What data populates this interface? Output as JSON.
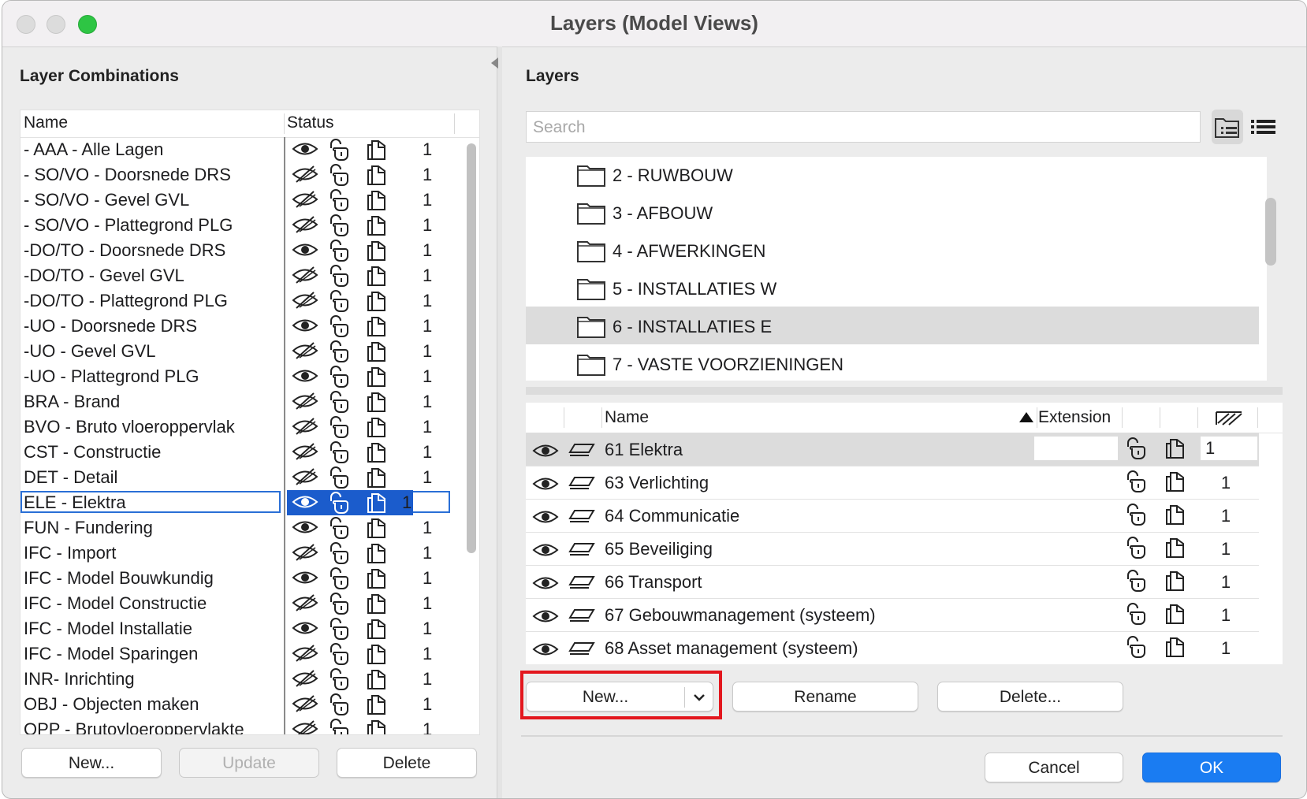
{
  "window": {
    "title": "Layers (Model Views)"
  },
  "left": {
    "section_title": "Layer Combinations",
    "columns": {
      "name": "Name",
      "status": "Status"
    },
    "rows": [
      {
        "name": "- AAA - Alle Lagen",
        "visible": true,
        "count": "1"
      },
      {
        "name": "- SO/VO - Doorsnede DRS",
        "visible": false,
        "count": "1"
      },
      {
        "name": "- SO/VO - Gevel GVL",
        "visible": false,
        "count": "1"
      },
      {
        "name": "- SO/VO - Plattegrond PLG",
        "visible": false,
        "count": "1"
      },
      {
        "name": "-DO/TO - Doorsnede DRS",
        "visible": true,
        "count": "1"
      },
      {
        "name": "-DO/TO - Gevel GVL",
        "visible": false,
        "count": "1"
      },
      {
        "name": "-DO/TO - Plattegrond PLG",
        "visible": false,
        "count": "1"
      },
      {
        "name": "-UO - Doorsnede DRS",
        "visible": true,
        "count": "1"
      },
      {
        "name": "-UO - Gevel GVL",
        "visible": false,
        "count": "1"
      },
      {
        "name": "-UO - Plattegrond PLG",
        "visible": true,
        "count": "1"
      },
      {
        "name": "BRA - Brand",
        "visible": false,
        "count": "1"
      },
      {
        "name": "BVO - Bruto vloeroppervlak",
        "visible": false,
        "count": "1"
      },
      {
        "name": "CST - Constructie",
        "visible": false,
        "count": "1"
      },
      {
        "name": "DET - Detail",
        "visible": false,
        "count": "1"
      },
      {
        "name": "ELE - Elektra",
        "visible": true,
        "count": "1",
        "selected": true
      },
      {
        "name": "FUN - Fundering",
        "visible": true,
        "count": "1"
      },
      {
        "name": "IFC - Import",
        "visible": false,
        "count": "1"
      },
      {
        "name": "IFC - Model Bouwkundig",
        "visible": true,
        "count": "1"
      },
      {
        "name": "IFC - Model Constructie",
        "visible": false,
        "count": "1"
      },
      {
        "name": "IFC - Model Installatie",
        "visible": true,
        "count": "1"
      },
      {
        "name": "IFC - Model Sparingen",
        "visible": false,
        "count": "1"
      },
      {
        "name": "INR- Inrichting",
        "visible": false,
        "count": "1"
      },
      {
        "name": "OBJ - Objecten maken",
        "visible": false,
        "count": "1"
      },
      {
        "name": "OPP - Brutovloeroppervlakte",
        "visible": false,
        "count": "1"
      }
    ],
    "buttons": {
      "new": "New...",
      "update": "Update",
      "delete": "Delete"
    }
  },
  "right": {
    "section_title": "Layers",
    "search_placeholder": "Search",
    "folders": [
      {
        "label": "2 - RUWBOUW"
      },
      {
        "label": "3 - AFBOUW"
      },
      {
        "label": "4 - AFWERKINGEN"
      },
      {
        "label": "5 - INSTALLATIES W"
      },
      {
        "label": "6 - INSTALLATIES E",
        "selected": true
      },
      {
        "label": "7 - VASTE VOORZIENINGEN"
      }
    ],
    "columns": {
      "name": "Name",
      "extension": "Extension"
    },
    "layers": [
      {
        "name": "61 Elektra",
        "count": "1",
        "selected": true
      },
      {
        "name": "63 Verlichting",
        "count": "1"
      },
      {
        "name": "64 Communicatie",
        "count": "1"
      },
      {
        "name": "65 Beveiliging",
        "count": "1"
      },
      {
        "name": "66 Transport",
        "count": "1"
      },
      {
        "name": "67 Gebouwmanagement (systeem)",
        "count": "1"
      },
      {
        "name": "68 Asset management (systeem)",
        "count": "1"
      }
    ],
    "buttons": {
      "new": "New...",
      "rename": "Rename",
      "delete": "Delete..."
    }
  },
  "footer": {
    "cancel": "Cancel",
    "ok": "OK"
  }
}
